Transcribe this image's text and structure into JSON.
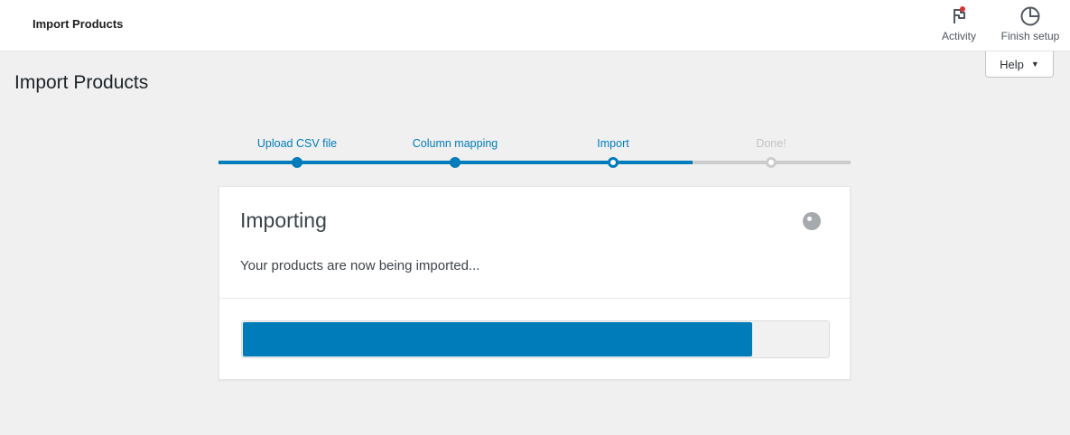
{
  "header": {
    "title": "Import Products",
    "actions": [
      {
        "label": "Activity",
        "icon": "flag-icon",
        "has_notification": true,
        "notification_color": "#d63638"
      },
      {
        "label": "Finish setup",
        "icon": "progress-circle-icon"
      }
    ]
  },
  "help": {
    "label": "Help",
    "icon": "caret-down-icon"
  },
  "page": {
    "title": "Import Products"
  },
  "stepper": {
    "steps": [
      {
        "label": "Upload CSV file",
        "state": "complete"
      },
      {
        "label": "Column mapping",
        "state": "complete"
      },
      {
        "label": "Import",
        "state": "current"
      },
      {
        "label": "Done!",
        "state": "pending"
      }
    ]
  },
  "card": {
    "title": "Importing",
    "description": "Your products are now being imported...",
    "spinner_icon": "loading-spinner-icon",
    "progress_percent": 87
  },
  "colors": {
    "accent": "#007cba",
    "pending": "#cccccc",
    "notification": "#d63638"
  }
}
